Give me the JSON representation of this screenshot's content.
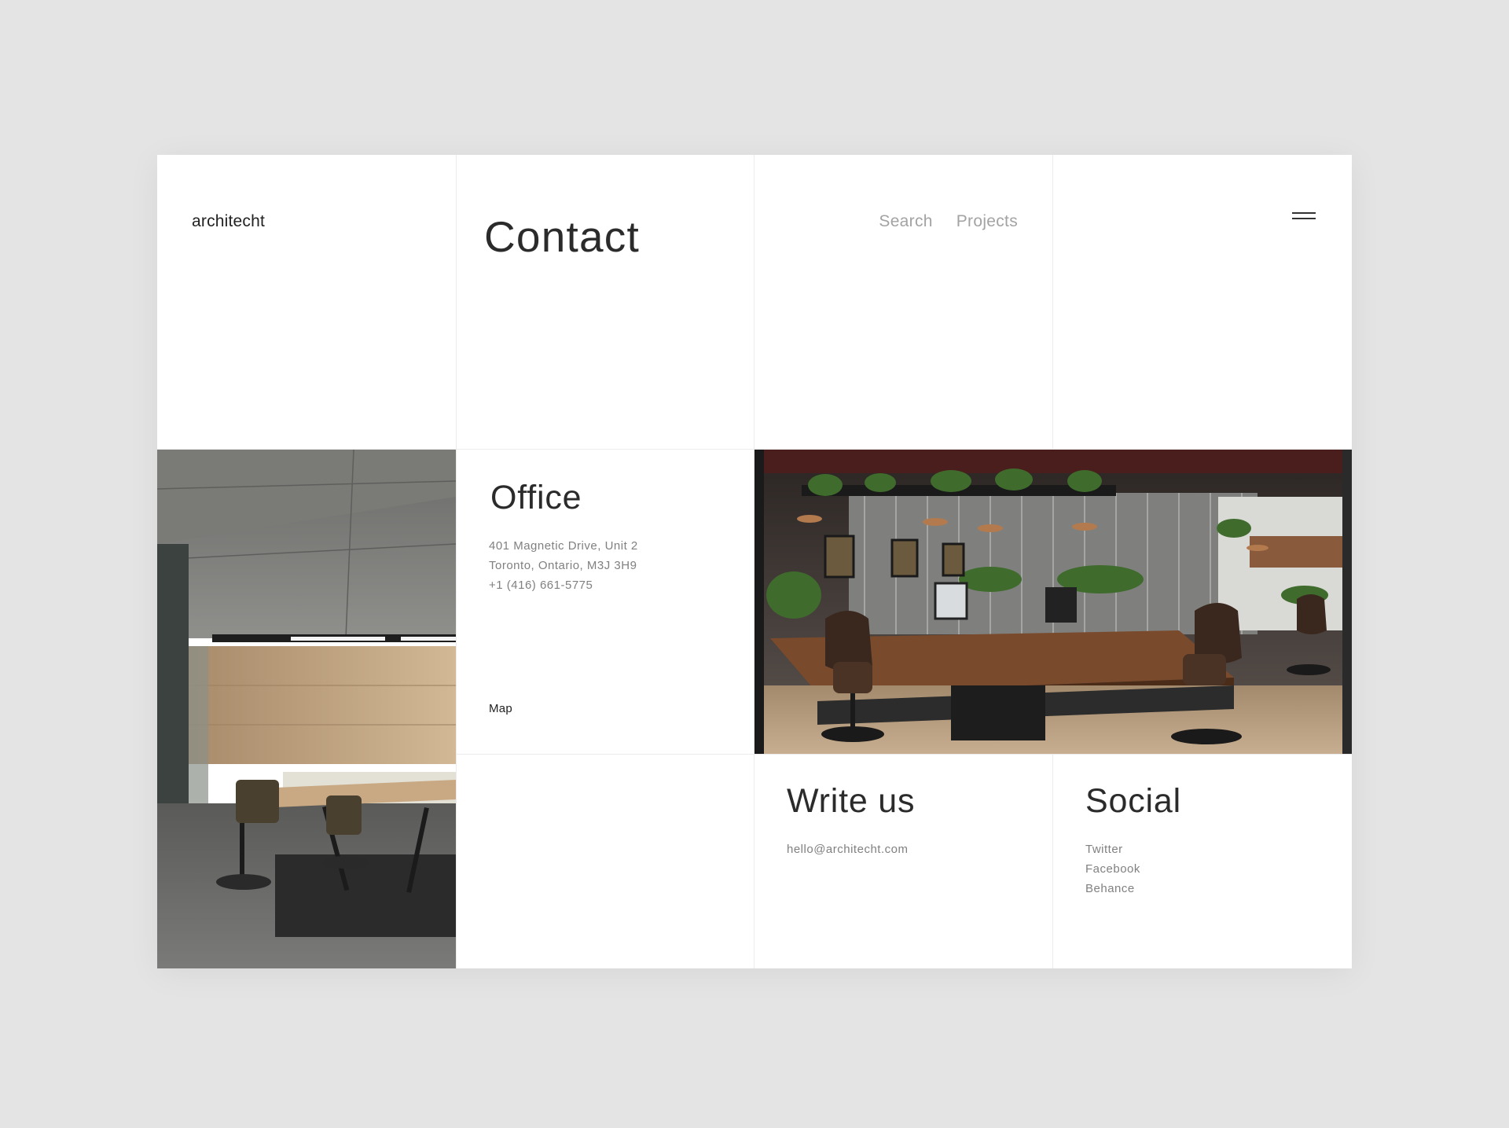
{
  "header": {
    "logo": "architecht",
    "page_title": "Contact",
    "nav": [
      "Search",
      "Projects"
    ],
    "menu_icon": "hamburger-menu-icon"
  },
  "office": {
    "title": "Office",
    "address_line1": "401 Magnetic Drive, Unit 2",
    "address_line2": "Toronto, Ontario, M3J 3H9",
    "phone": "+1 (416) 661-5775",
    "map_link": "Map"
  },
  "write_us": {
    "title": "Write us",
    "email": "hello@architecht.com"
  },
  "social": {
    "title": "Social",
    "links": [
      "Twitter",
      "Facebook",
      "Behance"
    ]
  },
  "colors": {
    "background": "#e4e4e4",
    "card": "#ffffff",
    "text_dark": "#2b2b2b",
    "text_muted": "#808080",
    "nav_muted": "#a3a3a3",
    "grid_line": "#ececec"
  }
}
